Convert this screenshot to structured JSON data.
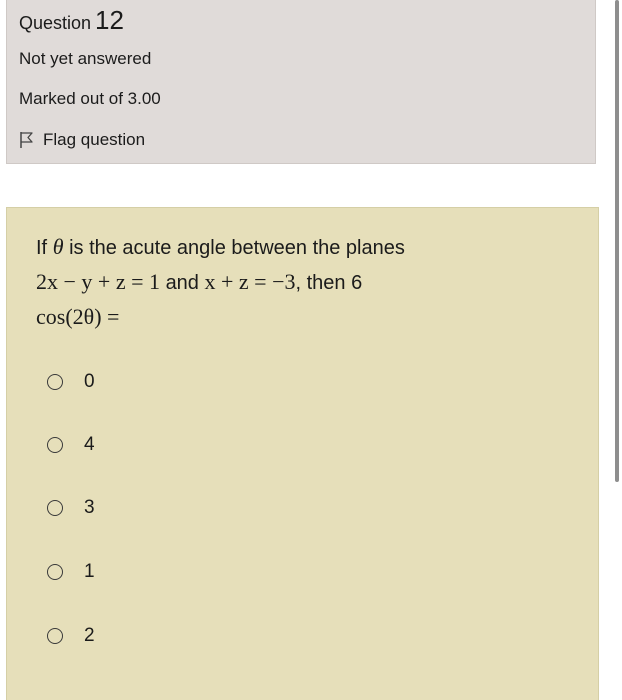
{
  "info": {
    "question_word": "Question",
    "question_number": "12",
    "state": "Not yet answered",
    "grade": "Marked out of 3.00",
    "flag_label": "Flag question",
    "flag_icon": "flag-icon"
  },
  "question": {
    "text_prefix": "If",
    "theta": "θ",
    "text_mid": "is the acute angle between the planes",
    "plane1": "2x − y + z = 1",
    "conj": "and",
    "plane2": "x + z = −3",
    "text_then": ", then 6",
    "expr": "cos(2θ) ="
  },
  "options": [
    {
      "label": "0"
    },
    {
      "label": "4"
    },
    {
      "label": "3"
    },
    {
      "label": "1"
    },
    {
      "label": "2"
    }
  ],
  "colors": {
    "info_bg": "#e0dbd9",
    "question_bg": "#e6dfba"
  }
}
